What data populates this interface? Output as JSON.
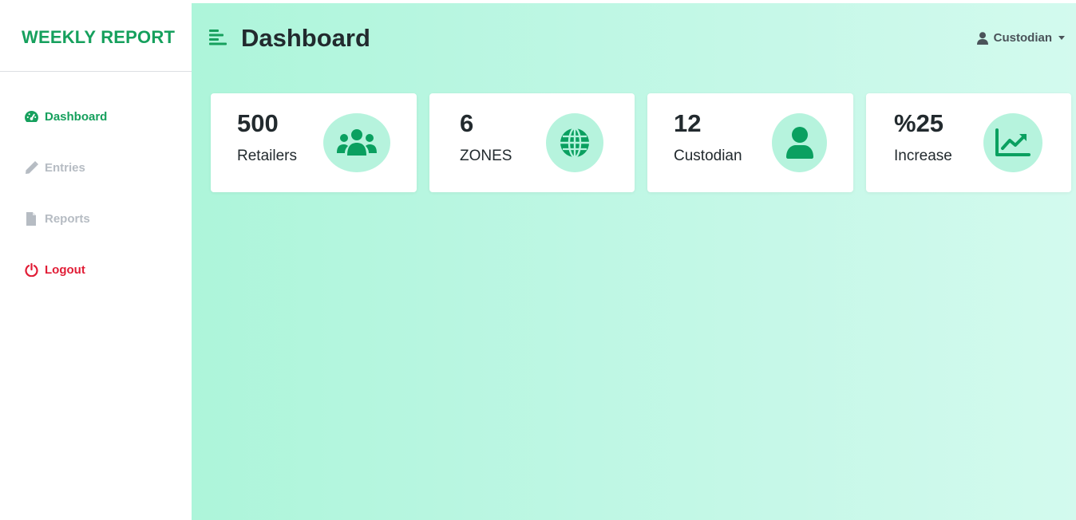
{
  "brand": "WEEKLY REPORT",
  "sidebar": {
    "items": [
      {
        "label": "Dashboard",
        "icon": "gauge-icon",
        "state": "active"
      },
      {
        "label": "Entries",
        "icon": "pencil-icon",
        "state": "muted"
      },
      {
        "label": "Reports",
        "icon": "file-icon",
        "state": "muted"
      },
      {
        "label": "Logout",
        "icon": "power-icon",
        "state": "danger"
      }
    ]
  },
  "header": {
    "title": "Dashboard",
    "user": "Custodian"
  },
  "cards": [
    {
      "value": "500",
      "label": "Retailers",
      "icon": "users-icon"
    },
    {
      "value": "6",
      "label": "ZONES",
      "icon": "globe-icon"
    },
    {
      "value": "12",
      "label": "Custodian",
      "icon": "user-icon"
    },
    {
      "value": "%25",
      "label": "Increase",
      "icon": "chart-line-icon"
    }
  ],
  "colors": {
    "brand_green": "#16a05d",
    "icon_green": "#0aa060",
    "icon_circle": "#b6f3dd",
    "danger": "#e11d36",
    "muted": "#b6bcc3",
    "main_bg_start": "#adf5da",
    "main_bg_end": "#d3faee"
  }
}
